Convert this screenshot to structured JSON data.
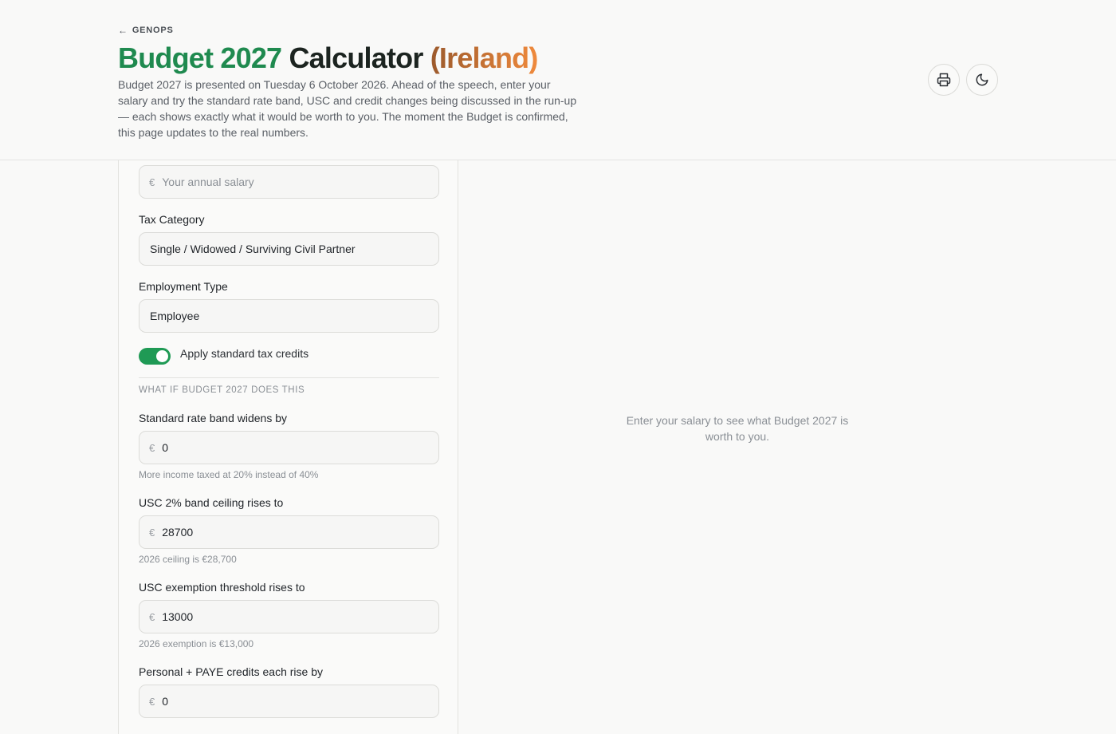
{
  "header": {
    "back_label": "GENOPS",
    "title_part1": "Budget 2027",
    "title_part2": "Calculator",
    "title_part3": "(Ireland)",
    "subtitle": "Budget 2027 is presented on Tuesday 6 October 2026. Ahead of the speech, enter your salary and try the standard rate band, USC and credit changes being discussed in the run-up — each shows exactly what it would be worth to you. The moment the Budget is confirmed, this page updates to the real numbers."
  },
  "toolbar": {
    "print_icon": "printer-icon",
    "theme_icon": "moon-icon"
  },
  "form": {
    "currency_symbol": "€",
    "salary_placeholder": "Your annual salary",
    "tax_category_label": "Tax Category",
    "tax_category_value": "Single / Widowed / Surviving Civil Partner",
    "employment_type_label": "Employment Type",
    "employment_type_value": "Employee",
    "credits_toggle_label": "Apply standard tax credits",
    "credits_toggle_on": true,
    "whatif_heading": "WHAT IF BUDGET 2027 DOES THIS",
    "rate_band_label": "Standard rate band widens by",
    "rate_band_value": "0",
    "rate_band_hint": "More income taxed at 20% instead of 40%",
    "usc_ceiling_label": "USC 2% band ceiling rises to",
    "usc_ceiling_value": "28700",
    "usc_ceiling_hint": "2026 ceiling is €28,700",
    "usc_exemption_label": "USC exemption threshold rises to",
    "usc_exemption_value": "13000",
    "usc_exemption_hint": "2026 exemption is €13,000",
    "credits_rise_label": "Personal + PAYE credits each rise by",
    "credits_rise_value": "0"
  },
  "results": {
    "empty_message": "Enter your salary to see what Budget 2027 is worth to you."
  },
  "colors": {
    "accent_green": "#1f9a55",
    "title_green": "#1f8a4f",
    "title_orange": "#d9772f"
  }
}
